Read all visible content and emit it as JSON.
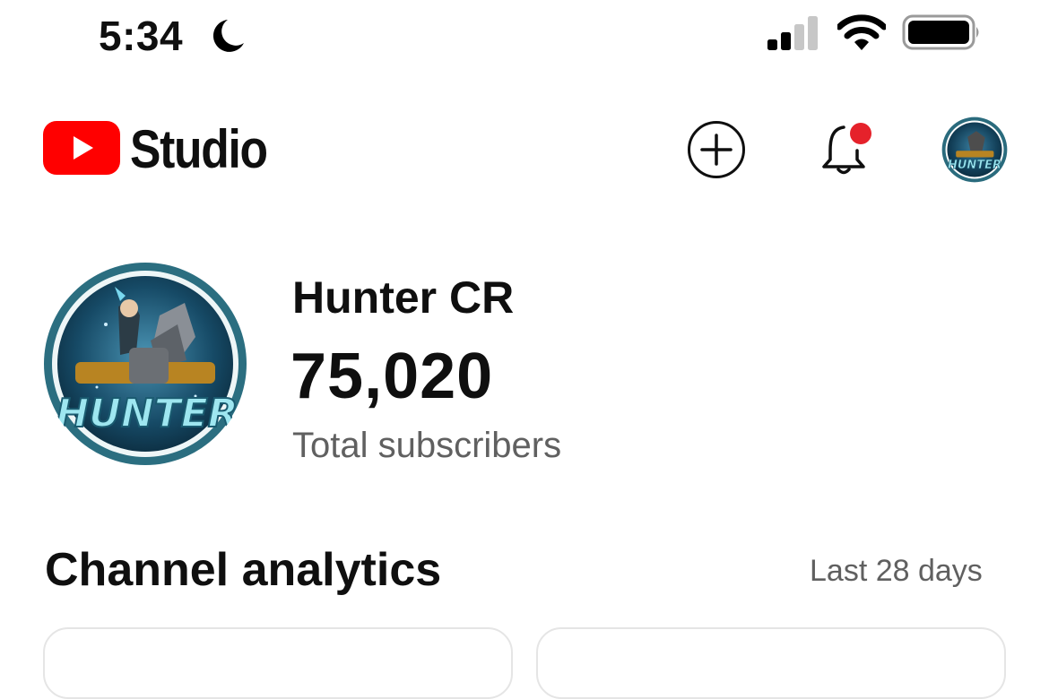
{
  "status_bar": {
    "time": "5:34",
    "moon_icon": "moon-icon",
    "signal_icon": "cellular-signal-icon",
    "wifi_icon": "wifi-icon",
    "battery_icon": "battery-icon"
  },
  "header": {
    "logo_icon": "youtube-logo-icon",
    "brand_text": "Studio",
    "create_icon": "plus-circle-icon",
    "notifications_icon": "bell-icon",
    "notification_badge_color": "#e5222b",
    "brand_color": "#ff0000",
    "avatar_label": "HUNTER"
  },
  "channel": {
    "name": "Hunter CR",
    "subscribers": "75,020",
    "subscribers_label": "Total subscribers",
    "avatar_label": "HUNTER"
  },
  "analytics": {
    "title": "Channel analytics",
    "range": "Last 28 days"
  }
}
